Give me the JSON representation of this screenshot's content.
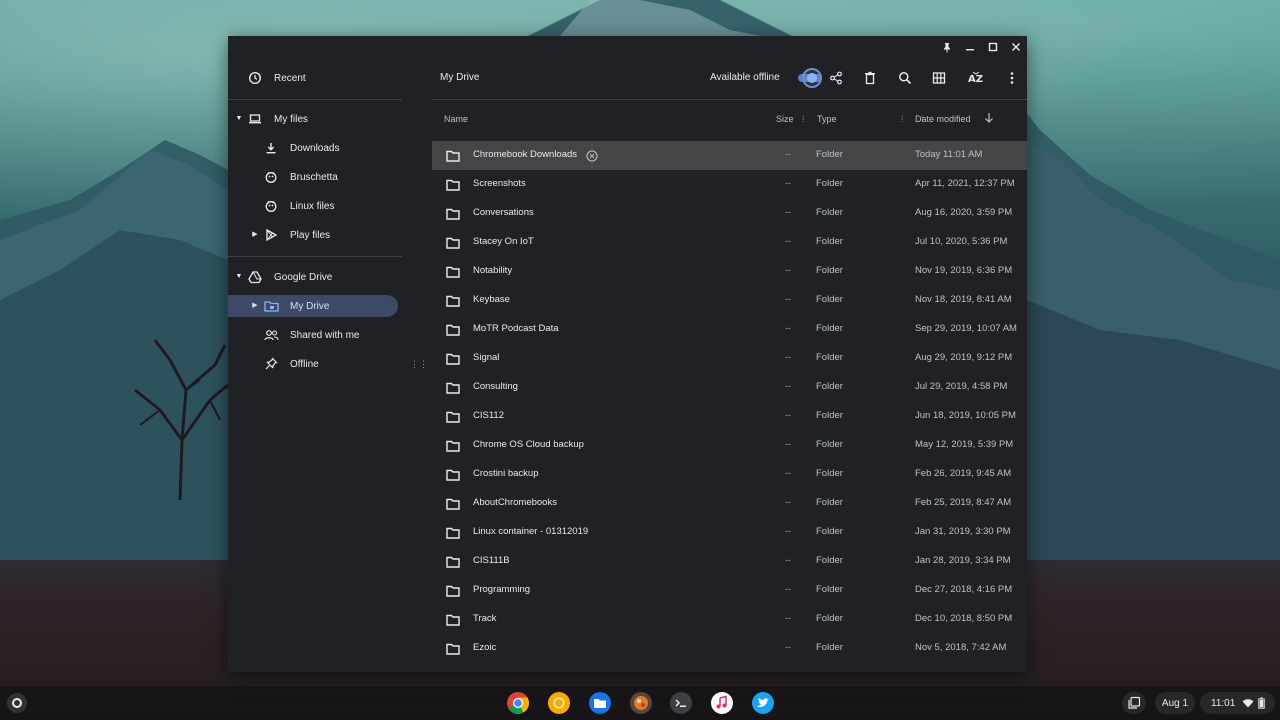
{
  "window": {
    "controls": {
      "pin": "pin-icon",
      "minimize": "minimize-icon",
      "maximize": "maximize-icon",
      "close": "close-icon"
    }
  },
  "sidebar": {
    "recent": "Recent",
    "my_files": "My files",
    "downloads": "Downloads",
    "bruschetta": "Bruschetta",
    "linux_files": "Linux files",
    "play_files": "Play files",
    "google_drive": "Google Drive",
    "my_drive": "My Drive",
    "shared_with_me": "Shared with me",
    "offline": "Offline"
  },
  "toolbar": {
    "title": "My Drive",
    "available_offline_label": "Available offline",
    "available_offline_on": true,
    "buttons": [
      "share-icon",
      "delete-icon",
      "search-icon",
      "grid-view-icon",
      "sort-az-icon",
      "more-vert-icon"
    ]
  },
  "columns": {
    "name": "Name",
    "size": "Size",
    "type": "Type",
    "date_modified": "Date modified"
  },
  "files": [
    {
      "name": "Chromebook Downloads",
      "size": "--",
      "type": "Folder",
      "date": "Today 11:01 AM",
      "selected": true,
      "offline_badge": true
    },
    {
      "name": "Screenshots",
      "size": "--",
      "type": "Folder",
      "date": "Apr 11, 2021, 12:37 PM"
    },
    {
      "name": "Conversations",
      "size": "--",
      "type": "Folder",
      "date": "Aug 16, 2020, 3:59 PM"
    },
    {
      "name": "Stacey On IoT",
      "size": "--",
      "type": "Folder",
      "date": "Jul 10, 2020, 5:36 PM"
    },
    {
      "name": "Notability",
      "size": "--",
      "type": "Folder",
      "date": "Nov 19, 2019, 6:36 PM"
    },
    {
      "name": "Keybase",
      "size": "--",
      "type": "Folder",
      "date": "Nov 18, 2019, 8:41 AM"
    },
    {
      "name": "MoTR Podcast Data",
      "size": "--",
      "type": "Folder",
      "date": "Sep 29, 2019, 10:07 AM"
    },
    {
      "name": "Signal",
      "size": "--",
      "type": "Folder",
      "date": "Aug 29, 2019, 9:12 PM"
    },
    {
      "name": "Consulting",
      "size": "--",
      "type": "Folder",
      "date": "Jul 29, 2019, 4:58 PM"
    },
    {
      "name": "CIS112",
      "size": "--",
      "type": "Folder",
      "date": "Jun 18, 2019, 10:05 PM"
    },
    {
      "name": "Chrome OS Cloud backup",
      "size": "--",
      "type": "Folder",
      "date": "May 12, 2019, 5:39 PM"
    },
    {
      "name": "Crostini backup",
      "size": "--",
      "type": "Folder",
      "date": "Feb 26, 2019, 9:45 AM"
    },
    {
      "name": "AboutChromebooks",
      "size": "--",
      "type": "Folder",
      "date": "Feb 25, 2019, 8:47 AM"
    },
    {
      "name": "Linux container - 01312019",
      "size": "--",
      "type": "Folder",
      "date": "Jan 31, 2019, 3:30 PM"
    },
    {
      "name": "CIS111B",
      "size": "--",
      "type": "Folder",
      "date": "Jan 28, 2019, 3:34 PM"
    },
    {
      "name": "Programming",
      "size": "--",
      "type": "Folder",
      "date": "Dec 27, 2018, 4:16 PM"
    },
    {
      "name": "Track",
      "size": "--",
      "type": "Folder",
      "date": "Dec 10, 2018, 8:50 PM"
    },
    {
      "name": "Ezoic",
      "size": "--",
      "type": "Folder",
      "date": "Nov 5, 2018, 7:42 AM"
    }
  ],
  "shelf": {
    "apps": [
      "chrome-icon",
      "chrome-canary-icon",
      "files-app-icon",
      "crostini-icon",
      "terminal-icon",
      "itunes-icon",
      "twitter-icon"
    ],
    "date": "Aug 1",
    "time": "11:01"
  },
  "colors": {
    "window_bg": "#202124",
    "selected_nav": "#3c4a66",
    "accent": "#8ab4f8",
    "selected_row": "#444547"
  }
}
